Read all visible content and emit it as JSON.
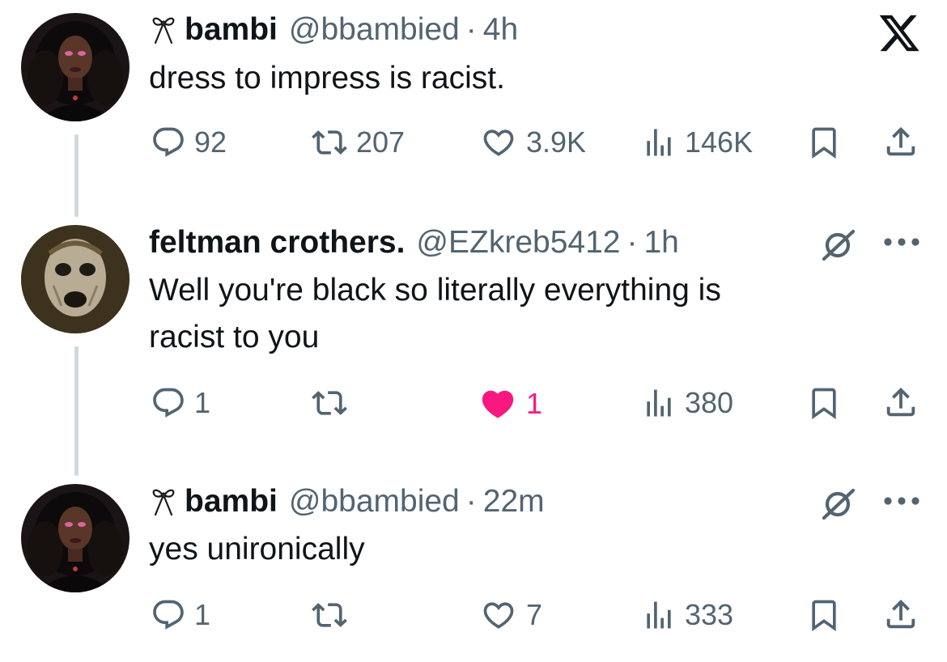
{
  "app": {
    "logo_icon": "x-logo-icon"
  },
  "colors": {
    "text": "#0f1419",
    "secondary": "#536471",
    "like_active": "#f91880",
    "thread_line": "#cfd9de"
  },
  "posts": [
    {
      "author_name": "bambi",
      "author_handle": "@bbambied",
      "separator": "·",
      "time": "4h",
      "name_prefix_icon": "bow-emoji-icon",
      "text_lines": [
        "dress to impress is racist."
      ],
      "actions": {
        "replies": "92",
        "reposts": "207",
        "likes": "3.9K",
        "views": "146K",
        "liked": false
      }
    },
    {
      "author_name": "feltman crothers.",
      "author_handle": "@EZkreb5412",
      "separator": "·",
      "time": "1h",
      "text_lines": [
        "Well you're black so literally everything is",
        "racist to you"
      ],
      "actions": {
        "replies": "1",
        "reposts": "",
        "likes": "1",
        "views": "380",
        "liked": true
      }
    },
    {
      "author_name": "bambi",
      "author_handle": "@bbambied",
      "separator": "·",
      "time": "22m",
      "name_prefix_icon": "bow-emoji-icon",
      "text_lines": [
        "yes unironically"
      ],
      "actions": {
        "replies": "1",
        "reposts": "",
        "likes": "7",
        "views": "333",
        "liked": false
      }
    }
  ]
}
